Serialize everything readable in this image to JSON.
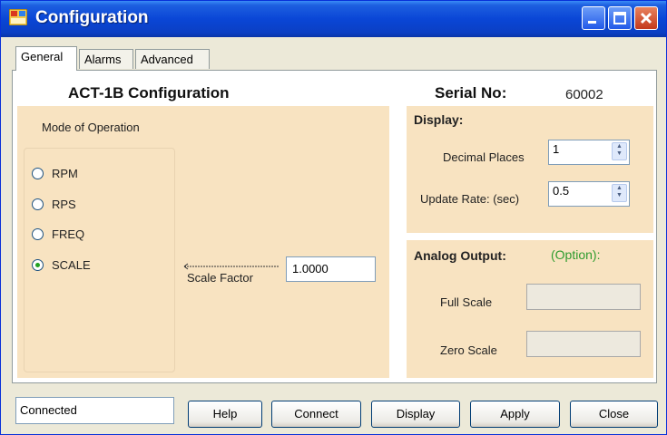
{
  "window": {
    "title": "Configuration"
  },
  "tabs": [
    {
      "label": "General",
      "active": true
    },
    {
      "label": "Alarms",
      "active": false
    },
    {
      "label": "Advanced",
      "active": false
    }
  ],
  "general": {
    "heading": "ACT-1B Configuration",
    "serial_label": "Serial No:",
    "serial_value": "60002",
    "mode": {
      "title": "Mode of Operation",
      "options": [
        {
          "label": "RPM",
          "selected": false
        },
        {
          "label": "RPS",
          "selected": false
        },
        {
          "label": "FREQ",
          "selected": false
        },
        {
          "label": "SCALE",
          "selected": true
        }
      ]
    },
    "scale_factor": {
      "label": "Scale Factor",
      "value": "1.0000"
    },
    "display": {
      "title": "Display:",
      "decimal_places_label": "Decimal Places",
      "decimal_places_value": "1",
      "update_rate_label": "Update Rate: (sec)",
      "update_rate_value": "0.5"
    },
    "analog_output": {
      "title": "Analog Output:",
      "option_label": "(Option):",
      "full_scale_label": "Full Scale",
      "full_scale_value": "",
      "zero_scale_label": "Zero Scale",
      "zero_scale_value": ""
    }
  },
  "footer": {
    "status": "Connected",
    "buttons": {
      "help": "Help",
      "connect": "Connect",
      "display": "Display",
      "apply": "Apply",
      "close": "Close"
    }
  },
  "colors": {
    "titlebar": "#0a46d6",
    "panel": "#f8e3c1",
    "option_green": "#2e9b2e",
    "radio_dot": "#21a121"
  },
  "icons": {
    "app": "config-app-icon",
    "minimize": "minimize-icon",
    "maximize": "maximize-icon",
    "close": "close-icon",
    "spin": "spin-updown-icon"
  }
}
